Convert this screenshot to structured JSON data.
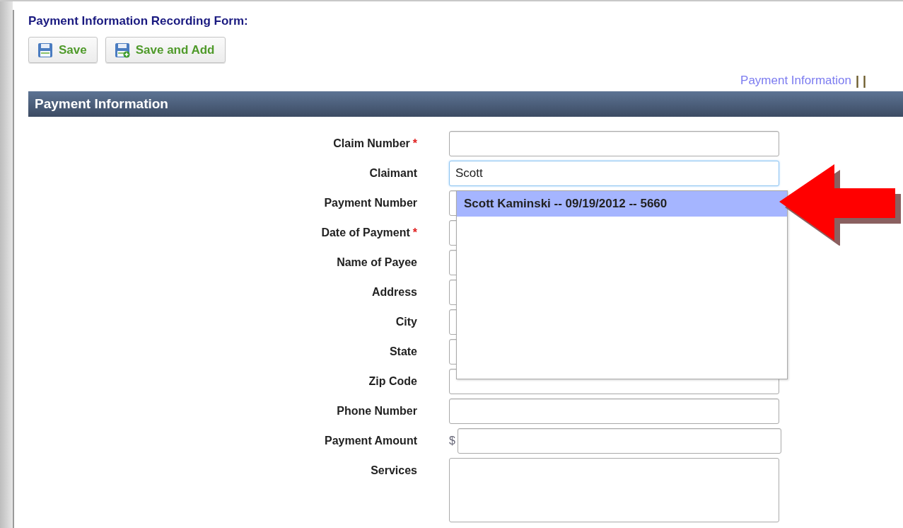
{
  "title": "Payment Information Recording Form:",
  "buttons": [
    {
      "label": "Save",
      "kind": "save"
    },
    {
      "label": "Save and Add",
      "kind": "save-add"
    }
  ],
  "nav": {
    "link": "Payment Information",
    "separator": "| |"
  },
  "section": {
    "title": "Payment Information"
  },
  "fields": [
    {
      "label": "Claim Number",
      "required_mark": "*",
      "kind": "text",
      "focused": false
    },
    {
      "label": "Claimant",
      "kind": "text",
      "value": "Scott",
      "focused": true,
      "suggestions": [
        {
          "text": "Scott Kaminski -- 09/19/2012 -- 5660",
          "selected": true
        }
      ]
    },
    {
      "label": "Payment Number",
      "kind": "text",
      "focused": false
    },
    {
      "label": "Date of Payment",
      "required_mark": "*",
      "kind": "text",
      "focused": false
    },
    {
      "label": "Name of Payee",
      "kind": "text",
      "focused": false
    },
    {
      "label": "Address",
      "kind": "text",
      "focused": false
    },
    {
      "label": "City",
      "kind": "text",
      "focused": false
    },
    {
      "label": "State",
      "kind": "text",
      "focused": false
    },
    {
      "label": "Zip Code",
      "kind": "text",
      "focused": false
    },
    {
      "label": "Phone Number",
      "kind": "text",
      "focused": false
    },
    {
      "label": "Payment Amount",
      "kind": "money",
      "prefix": "$",
      "focused": false
    },
    {
      "label": "Services",
      "kind": "textarea",
      "focused": false
    }
  ]
}
